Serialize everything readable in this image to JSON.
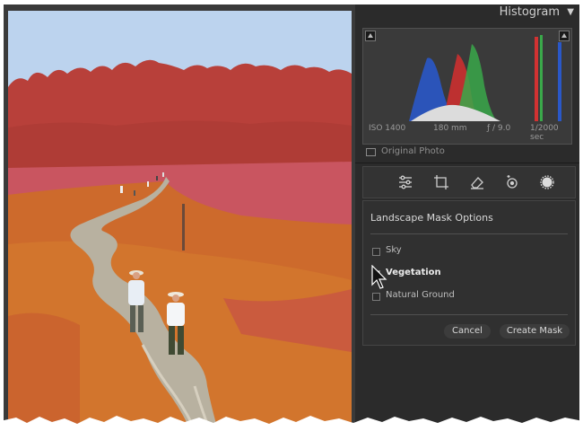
{
  "panel": {
    "histogram": {
      "title": "Histogram",
      "iso": "ISO 1400",
      "focal": "180 mm",
      "aperture": "ƒ / 9.0",
      "shutter": "1/2000 sec"
    },
    "original_photo_label": "Original Photo"
  },
  "tools": [
    "sliders-icon",
    "crop-icon",
    "eraser-icon",
    "redeye-icon",
    "masking-icon"
  ],
  "mask_options": {
    "title": "Landscape Mask Options",
    "options": [
      {
        "label": "Sky",
        "checked": false
      },
      {
        "label": "Vegetation",
        "checked": true
      },
      {
        "label": "Natural Ground",
        "checked": false
      }
    ],
    "cancel_label": "Cancel",
    "create_label": "Create Mask"
  },
  "colors": {
    "mask_overlay": "#c8503c",
    "sky": "#bcd4ee",
    "panel_bg": "#2b2b2b"
  }
}
